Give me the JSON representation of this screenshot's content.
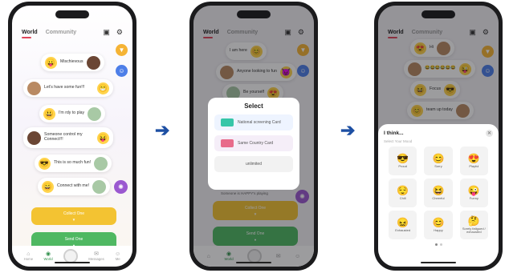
{
  "phone1": {
    "tabs": [
      "World",
      "Community"
    ],
    "feed": [
      {
        "text": "Mischievous",
        "emoji": "😛",
        "avatar": "dark"
      },
      {
        "text": "Let's have some fun!!!",
        "emoji": "😁",
        "avatar": "tan"
      },
      {
        "text": "I'm rdy to play",
        "emoji": "😃",
        "avatar": "green"
      },
      {
        "text": "Someone control my Connect!!!",
        "emoji": "😝",
        "avatar": "dark"
      },
      {
        "text": "This is so much fun!",
        "emoji": "😎",
        "avatar": "green"
      },
      {
        "text": "Connect with me!",
        "emoji": "😄",
        "avatar": "green"
      }
    ],
    "collect_label": "Collect One",
    "send_label": "Send One",
    "tabbar": [
      "Home",
      "World",
      "",
      "Messages",
      "Me"
    ]
  },
  "phone2": {
    "tabs": [
      "World",
      "Community"
    ],
    "feed": [
      {
        "text": "I am here",
        "emoji": "😊"
      },
      {
        "text": "Anyone looking to fun",
        "emoji": "😈"
      },
      {
        "text": "Be yourself",
        "emoji": "😍"
      }
    ],
    "modal": {
      "title": "Select",
      "options": [
        "National screening Card",
        "Same Country Card",
        "unlimited"
      ]
    },
    "partial_line": "Someone is HAPPY's playing",
    "collect_label": "Collect One",
    "send_label": "Send One",
    "tabbar": [
      "",
      "World",
      "",
      "",
      ""
    ]
  },
  "phone3": {
    "tabs": [
      "World",
      "Community"
    ],
    "feed": [
      {
        "text": "Hi",
        "emoji": "😍"
      },
      {
        "text": "😂😂😂😂😂😂",
        "emoji": "😜"
      },
      {
        "text": "Focus",
        "emoji": "😎"
      },
      {
        "text": "team up today",
        "emoji": "😀"
      }
    ],
    "sheet": {
      "title": "I think...",
      "subtitle": "Select Your Mood",
      "moods": [
        {
          "emoji": "😎",
          "label": "Proud"
        },
        {
          "emoji": "😊",
          "label": "Sorry"
        },
        {
          "emoji": "😍",
          "label": "Playful"
        },
        {
          "emoji": "😌",
          "label": "Chill"
        },
        {
          "emoji": "😆",
          "label": "Cheerful"
        },
        {
          "emoji": "😜",
          "label": "Funny"
        },
        {
          "emoji": "😖",
          "label": "Exhausted"
        },
        {
          "emoji": "😊",
          "label": "Happy"
        },
        {
          "emoji": "🤔",
          "label": "Sorely fatigued / exhausted"
        }
      ]
    }
  },
  "colors": {
    "accent": "#e0455a",
    "arrow": "#1d4fa3",
    "green": "#4fb862",
    "yellow": "#f3c332"
  }
}
